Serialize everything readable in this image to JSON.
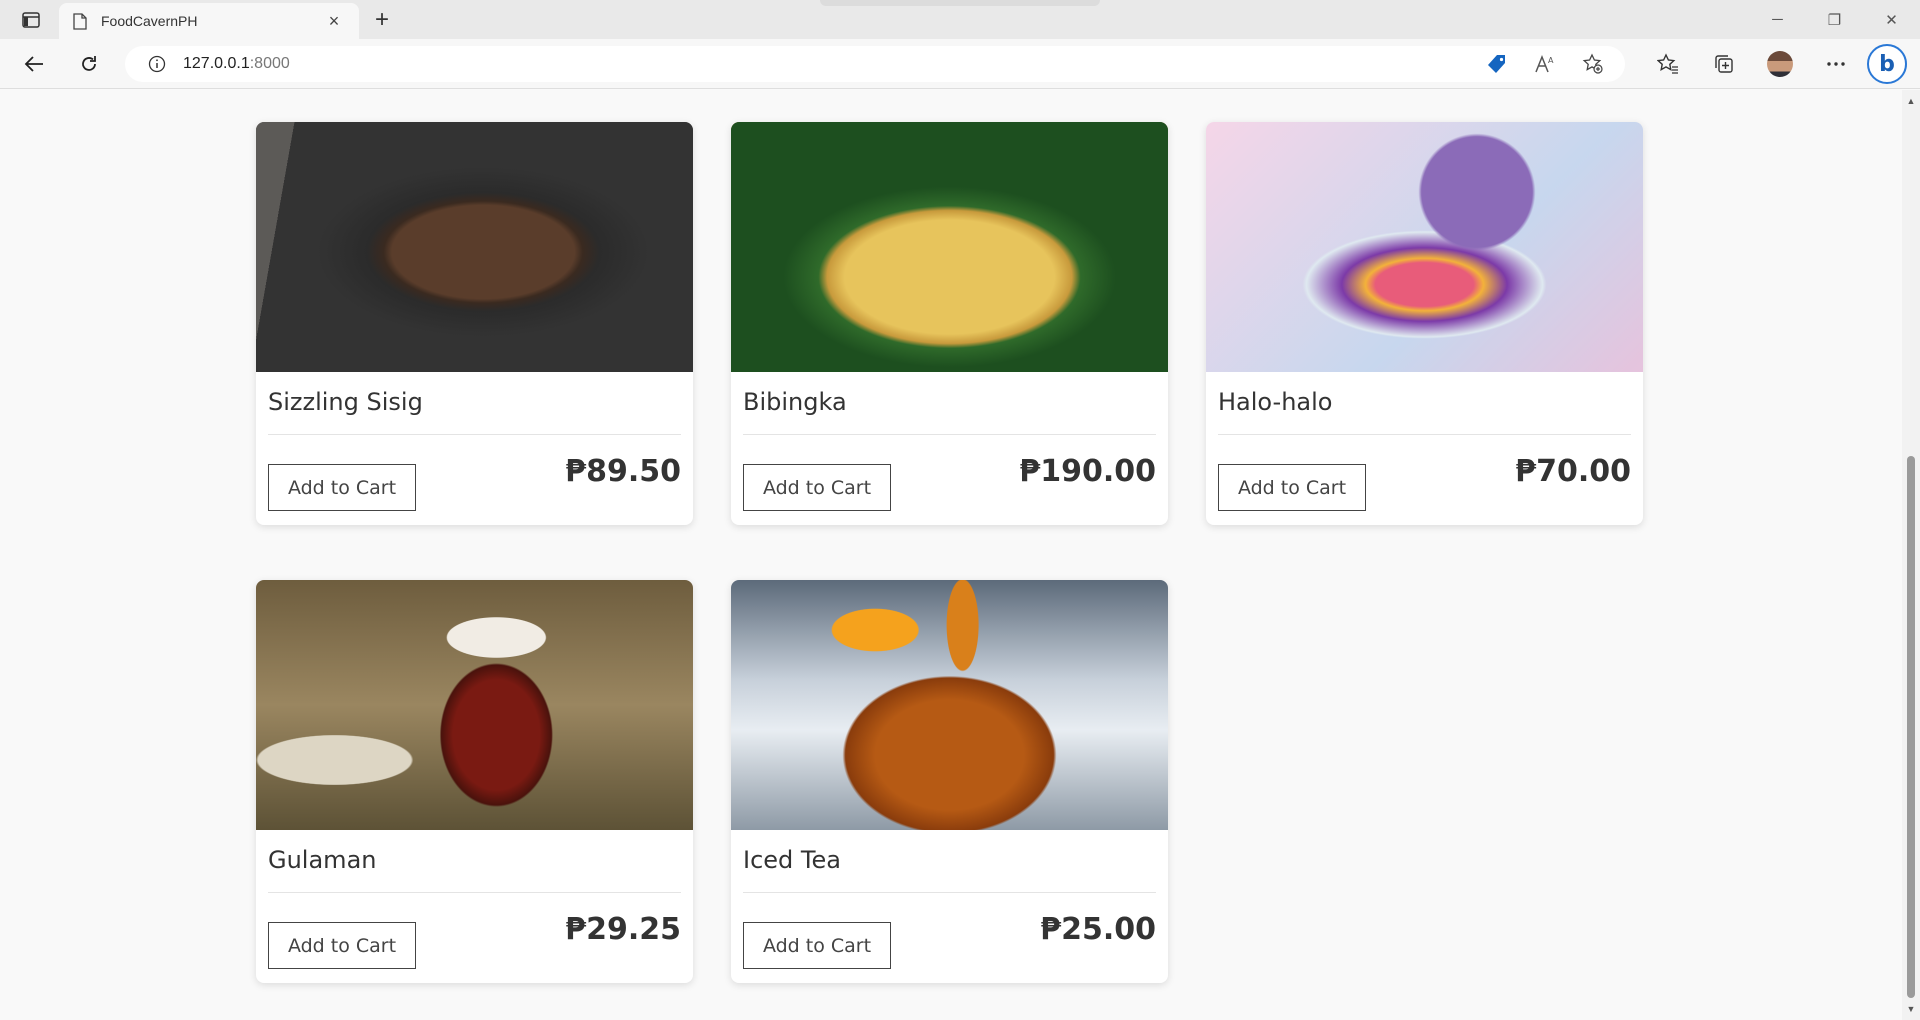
{
  "browser": {
    "tab_title": "FoodCavernPH",
    "new_tab_symbol": "+",
    "url_host": "127.0.0.1",
    "url_port": ":8000"
  },
  "products": [
    {
      "name": "Sizzling Sisig",
      "price": "₱89.50",
      "button": "Add to Cart",
      "image": "sizzling-sisig-image"
    },
    {
      "name": "Bibingka",
      "price": "₱190.00",
      "button": "Add to Cart",
      "image": "bibingka-image"
    },
    {
      "name": "Halo-halo",
      "price": "₱70.00",
      "button": "Add to Cart",
      "image": "halo-halo-image"
    },
    {
      "name": "Gulaman",
      "price": "₱29.25",
      "button": "Add to Cart",
      "image": "gulaman-image"
    },
    {
      "name": "Iced Tea",
      "price": "₱25.00",
      "button": "Add to Cart",
      "image": "iced-tea-image"
    }
  ]
}
